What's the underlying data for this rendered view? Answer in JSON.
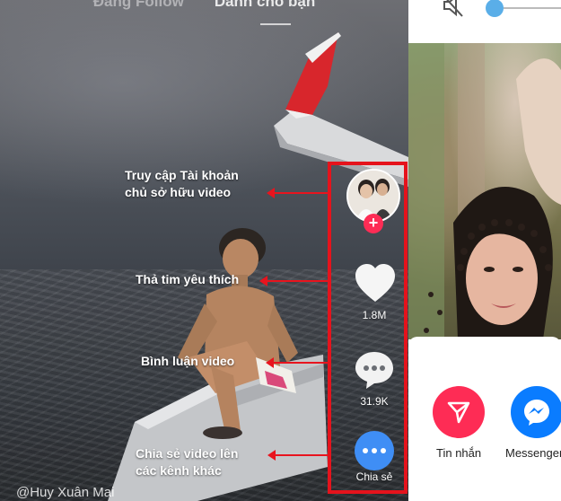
{
  "top_tabs": {
    "following": "Đang Follow",
    "for_you": "Dành cho bạn"
  },
  "annotations": {
    "avatar_line1": "Truy cập Tài khoản",
    "avatar_line2": "chủ sở hữu video",
    "like": "Thả tim yêu thích",
    "comment": "Bình luận video",
    "share_line1": "Chia sẻ video lên",
    "share_line2": "các kênh khác"
  },
  "actions": {
    "like_count": "1.8M",
    "comment_count": "31.9K",
    "share_label": "Chia sẻ",
    "follow_symbol": "+"
  },
  "username": "@Huy Xuân Mai",
  "share_sheet": {
    "message_label": "Tin nhắn",
    "messenger_label": "Messenger"
  },
  "colors": {
    "highlight_red": "#e5131c",
    "tiktok_pink": "#fe2c55",
    "share_blue": "#3f8ef5",
    "messenger_blue": "#0a7cff"
  },
  "icons": {
    "like": "heart-icon",
    "comment": "comment-bubble-icon",
    "share": "more-dots-icon",
    "mute": "speaker-mute-icon",
    "message": "paper-plane-icon",
    "messenger": "messenger-icon"
  }
}
